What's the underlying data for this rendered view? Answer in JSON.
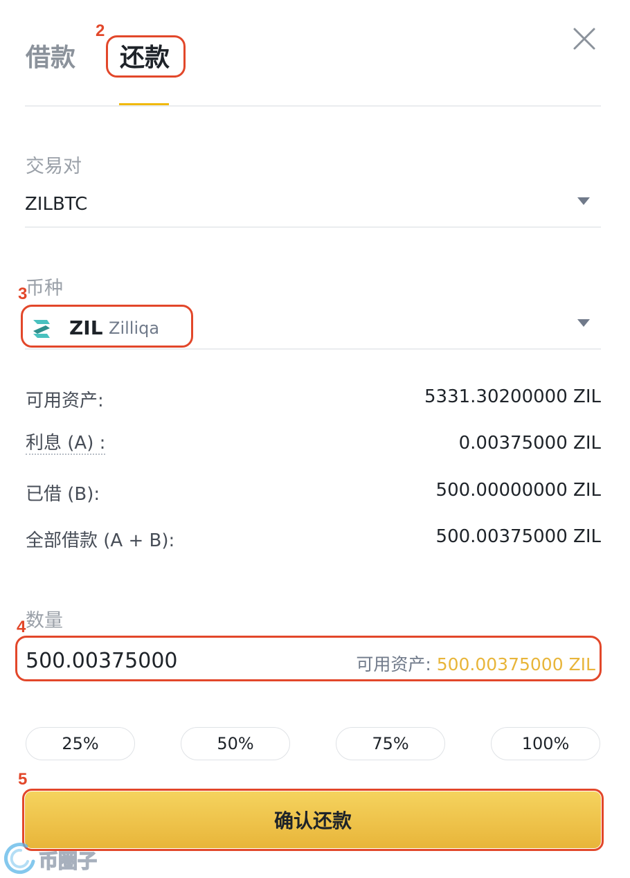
{
  "tabs": [
    {
      "label": "借款",
      "active": false
    },
    {
      "label": "还款",
      "active": true
    }
  ],
  "pair": {
    "label": "交易对",
    "value": "ZILBTC"
  },
  "coin": {
    "label": "币种",
    "symbol": "ZIL",
    "name": "Zilliqa"
  },
  "info_rows": [
    {
      "label": "可用资产:",
      "value": "5331.30200000 ZIL"
    },
    {
      "label": "利息 (A) :",
      "value": "0.00375000 ZIL"
    },
    {
      "label": "已借 (B):",
      "value": "500.00000000 ZIL"
    },
    {
      "label": "全部借款 (A + B):",
      "value": "500.00375000 ZIL"
    }
  ],
  "quantity": {
    "label": "数量",
    "value": "500.00375000",
    "available_label": "可用资产:",
    "available_value": "500.00375000 ZIL"
  },
  "percent_buttons": [
    "25%",
    "50%",
    "75%",
    "100%"
  ],
  "confirm_label": "确认还款",
  "annotations": [
    "2",
    "3",
    "4",
    "5"
  ],
  "watermark": "币圈子",
  "colors": {
    "accent": "#f0b90b",
    "annotation": "#e2472a",
    "available_value": "#e8b53a",
    "zil_logo": "#49c1bf"
  }
}
